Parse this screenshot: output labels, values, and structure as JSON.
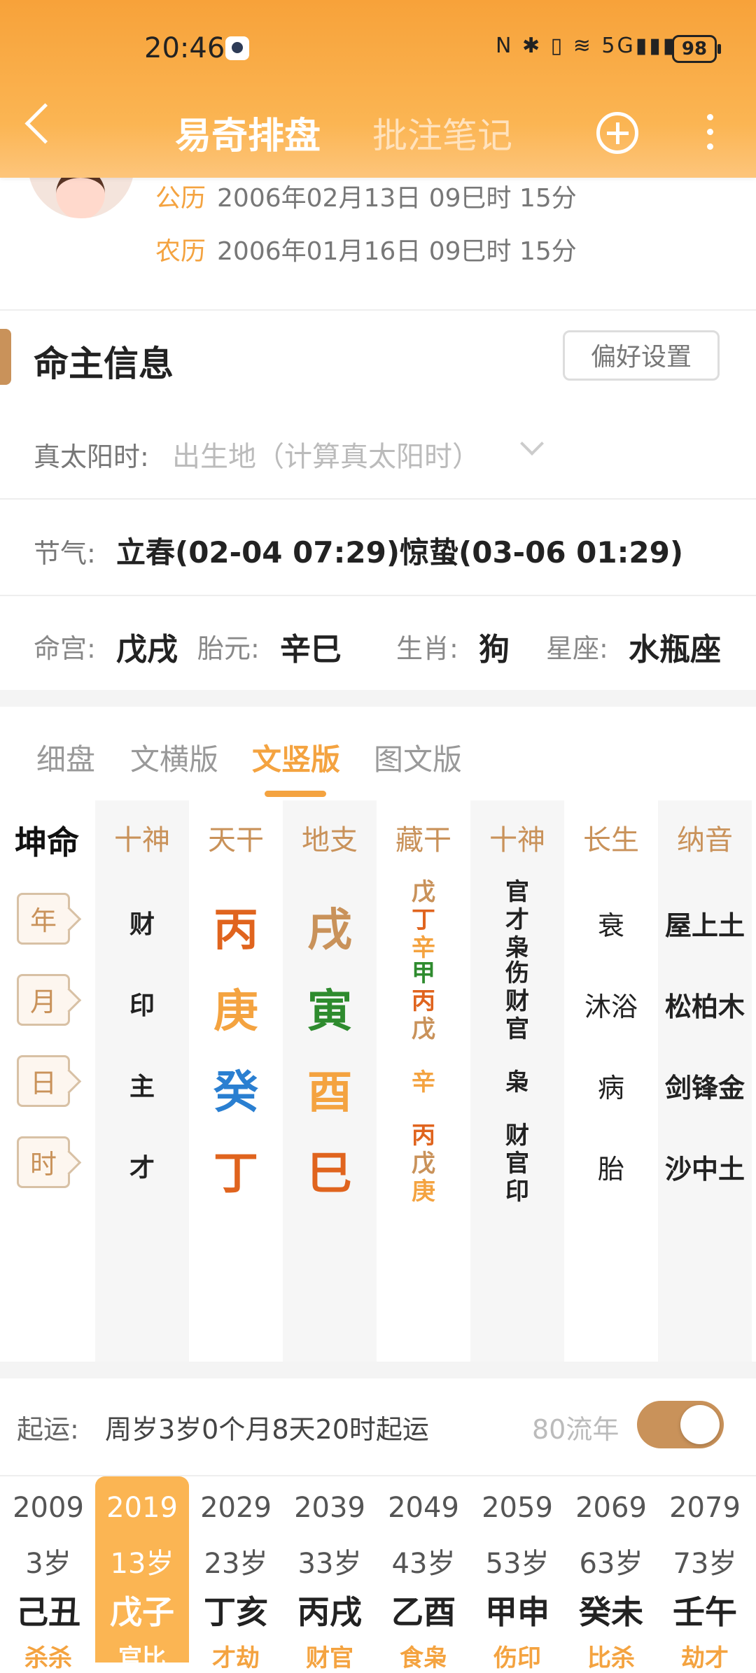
{
  "status": {
    "time": "20:46",
    "icons": "N ✱ ▯ ≋ 5G▮▮▮",
    "battery": "98"
  },
  "nav": {
    "title": "易奇排盘",
    "subtitle": "批注笔记"
  },
  "dates": {
    "solar_label": "公历",
    "solar_value": "2006年02月13日 09巳时 15分",
    "lunar_label": "农历",
    "lunar_value": "2006年01月16日 09巳时 15分"
  },
  "info": {
    "title": "命主信息",
    "pref_button": "偏好设置",
    "true_solar_label": "真太阳时:",
    "true_solar_placeholder": "出生地（计算真太阳时）",
    "jieqi_label": "节气:",
    "jieqi_value": "立春(02-04 07:29)惊蛰(03-06 01:29)",
    "minggong_label": "命宫:",
    "minggong_value": "戊戌",
    "taiyuan_label": "胎元:",
    "taiyuan_value": "辛巳",
    "shengxiao_label": "生肖:",
    "shengxiao_value": "狗",
    "xingzuo_label": "星座:",
    "xingzuo_value": "水瓶座"
  },
  "tabs": [
    "细盘",
    "文横版",
    "文竖版",
    "图文版"
  ],
  "active_tab": "文竖版",
  "grid": {
    "headers": [
      "坤命",
      "十神",
      "天干",
      "地支",
      "藏干",
      "十神",
      "长生",
      "纳音"
    ],
    "colors": {
      "fire": "#e0641e",
      "earth": "#c9925a",
      "metal": "#f4a340",
      "wood": "#2e8b2e",
      "water": "#2a7fd1"
    },
    "rows": [
      {
        "pillar": "年",
        "shishen": "财",
        "gan": "丙",
        "gan_color": "#e0641e",
        "zhi": "戌",
        "zhi_color": "#c9925a",
        "canggan": [
          "戊",
          "丁",
          "辛"
        ],
        "canggan_colors": [
          "#c9925a",
          "#e0641e",
          "#f4a340"
        ],
        "canggan_shishen": [
          "官",
          "才",
          "枭"
        ],
        "changsheng": "衰",
        "nayin": "屋上土"
      },
      {
        "pillar": "月",
        "shishen": "印",
        "gan": "庚",
        "gan_color": "#f4a340",
        "zhi": "寅",
        "zhi_color": "#2e8b2e",
        "canggan": [
          "甲",
          "丙",
          "戊"
        ],
        "canggan_colors": [
          "#2e8b2e",
          "#e0641e",
          "#c9925a"
        ],
        "canggan_shishen": [
          "伤",
          "财",
          "官"
        ],
        "changsheng": "沐浴",
        "nayin": "松柏木"
      },
      {
        "pillar": "日",
        "shishen": "主",
        "gan": "癸",
        "gan_color": "#2a7fd1",
        "zhi": "酉",
        "zhi_color": "#f4a340",
        "canggan": [
          "辛"
        ],
        "canggan_colors": [
          "#f4a340"
        ],
        "canggan_shishen": [
          "枭"
        ],
        "changsheng": "病",
        "nayin": "剑锋金"
      },
      {
        "pillar": "时",
        "shishen": "才",
        "gan": "丁",
        "gan_color": "#e0641e",
        "zhi": "巳",
        "zhi_color": "#e0641e",
        "canggan": [
          "丙",
          "戊",
          "庚"
        ],
        "canggan_colors": [
          "#e0641e",
          "#c9925a",
          "#f4a340"
        ],
        "canggan_shishen": [
          "财",
          "官",
          "印"
        ],
        "changsheng": "胎",
        "nayin": "沙中土"
      }
    ]
  },
  "dayun": {
    "qiyun_label": "起运:",
    "qiyun_value": "周岁3岁0个月8天20时起运",
    "liunian_label": "80流年",
    "liunian_toggle_on": true,
    "selected_index": 1,
    "items": [
      {
        "year": "2009",
        "age": "3岁",
        "ganzhi": "己丑",
        "shishen": "杀杀"
      },
      {
        "year": "2019",
        "age": "13岁",
        "ganzhi": "戊子",
        "shishen": "官比"
      },
      {
        "year": "2029",
        "age": "23岁",
        "ganzhi": "丁亥",
        "shishen": "才劫"
      },
      {
        "year": "2039",
        "age": "33岁",
        "ganzhi": "丙戌",
        "shishen": "财官"
      },
      {
        "year": "2049",
        "age": "43岁",
        "ganzhi": "乙酉",
        "shishen": "食枭"
      },
      {
        "year": "2059",
        "age": "53岁",
        "ganzhi": "甲申",
        "shishen": "伤印"
      },
      {
        "year": "2069",
        "age": "63岁",
        "ganzhi": "癸未",
        "shishen": "比杀"
      },
      {
        "year": "2079",
        "age": "73岁",
        "ganzhi": "壬午",
        "shishen": "劫才"
      }
    ]
  }
}
